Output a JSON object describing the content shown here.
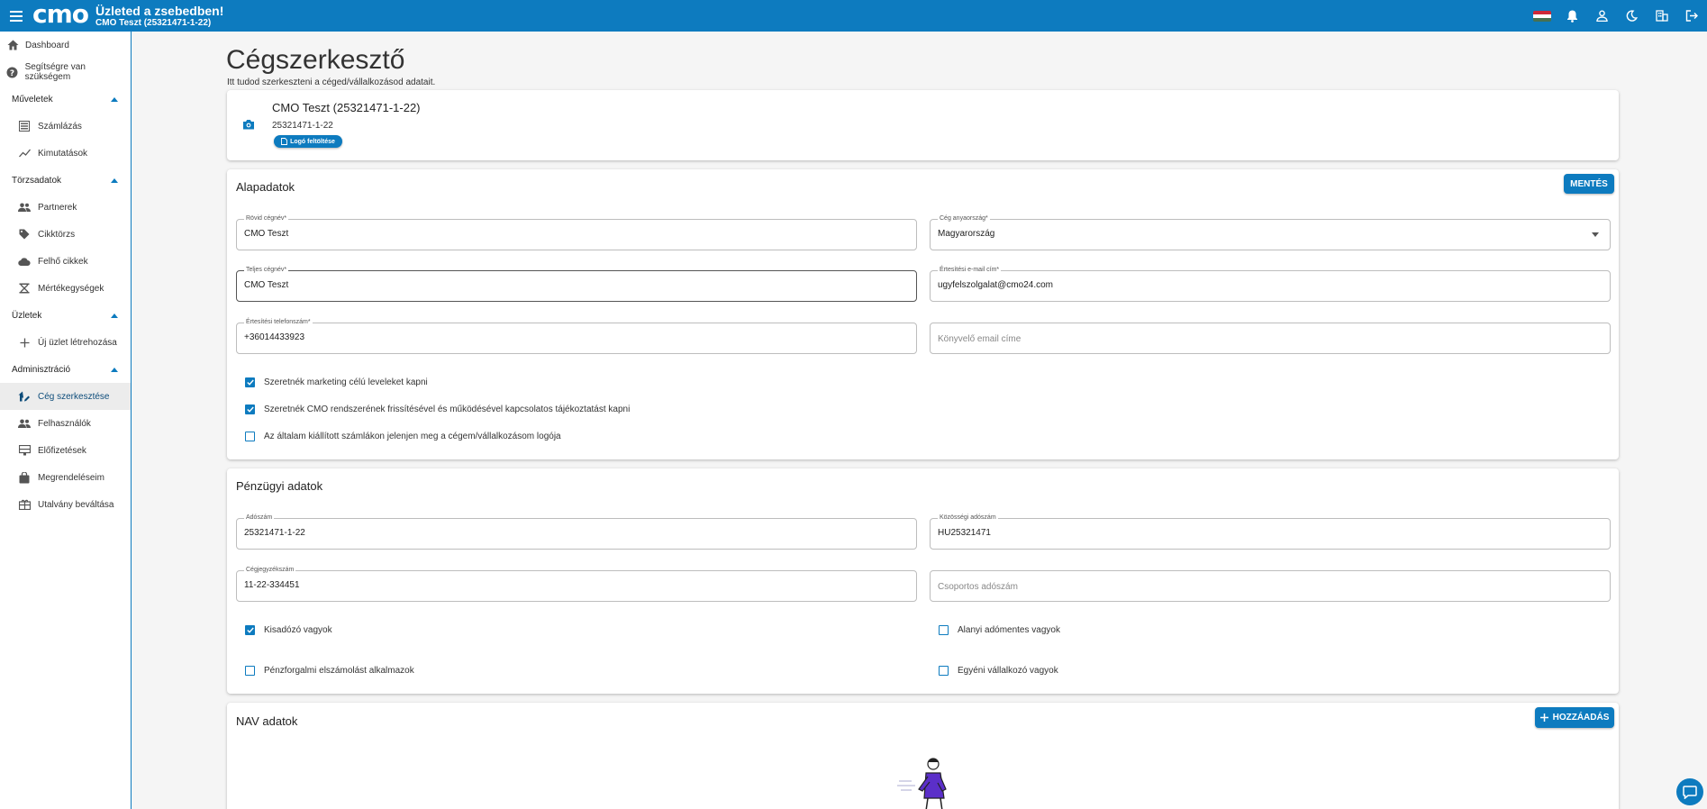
{
  "header": {
    "logo": "cmo",
    "title": "Üzleted a zsebedben!",
    "subtitle": "CMO Teszt (25321471-1-22)"
  },
  "sidebar": {
    "dashboard": "Dashboard",
    "help": "Segítségre van szükségem",
    "sections": [
      {
        "label": "Műveletek",
        "items": [
          "Számlázás",
          "Kimutatások"
        ]
      },
      {
        "label": "Törzsadatok",
        "items": [
          "Partnerek",
          "Cikktörzs",
          "Felhő cikkek",
          "Mértékegységek"
        ]
      },
      {
        "label": "Üzletek",
        "items": [
          "Új üzlet létrehozása"
        ]
      },
      {
        "label": "Adminisztráció",
        "items": [
          "Cég szerkesztése",
          "Felhasználók",
          "Előfizetések",
          "Megrendeléseim",
          "Utalvány beváltása"
        ]
      }
    ]
  },
  "page": {
    "title": "Cégszerkesztő",
    "subtitle": "Itt tudod szerkeszteni a céged/vállalkozásod adatait."
  },
  "company": {
    "name": "CMO Teszt (25321471-1-22)",
    "tax_number": "25321471-1-22",
    "logo_upload_label": "Logó feltöltése"
  },
  "basic": {
    "title": "Alapadatok",
    "save_label": "MENTÉS",
    "short_name_label": "Rövid cégnév*",
    "short_name_value": "CMO Teszt",
    "country_label": "Cég anyaország*",
    "country_value": "Magyarország",
    "full_name_label": "Teljes cégnév*",
    "full_name_value": "CMO Teszt",
    "email_label": "Értesítési e-mail cím*",
    "email_value": "ugyfelszolgalat@cmo24.com",
    "phone_label": "Értesítési telefonszám*",
    "phone_value": "+36014433923",
    "accountant_email_placeholder": "Könyvelő email címe",
    "checkboxes": [
      {
        "label": "Szeretnék marketing célú leveleket kapni",
        "checked": true
      },
      {
        "label": "Szeretnék CMO rendszerének frissítésével és működésével kapcsolatos tájékoztatást kapni",
        "checked": true
      },
      {
        "label": "Az általam kiállított számlákon jelenjen meg a cégem/vállalkozásom logója",
        "checked": false
      }
    ]
  },
  "finance": {
    "title": "Pénzügyi adatok",
    "tax_label": "Adószám",
    "tax_value": "25321471-1-22",
    "eu_tax_label": "Közösségi adószám",
    "eu_tax_value": "HU25321471",
    "reg_label": "Cégjegyzékszám",
    "reg_value": "11-22-334451",
    "group_tax_placeholder": "Csoportos adószám",
    "checkboxes": [
      {
        "label": "Kisadózó vagyok",
        "checked": true
      },
      {
        "label": "Alanyi adómentes vagyok",
        "checked": false
      },
      {
        "label": "Pénzforgalmi elszámolást alkalmazok",
        "checked": false
      },
      {
        "label": "Egyéni vállalkozó vagyok",
        "checked": false
      }
    ]
  },
  "nav": {
    "title": "NAV adatok",
    "add_label": "HOZZÁADÁS"
  },
  "colors": {
    "primary": "#0d7bbf",
    "background": "#f5f5f5"
  }
}
